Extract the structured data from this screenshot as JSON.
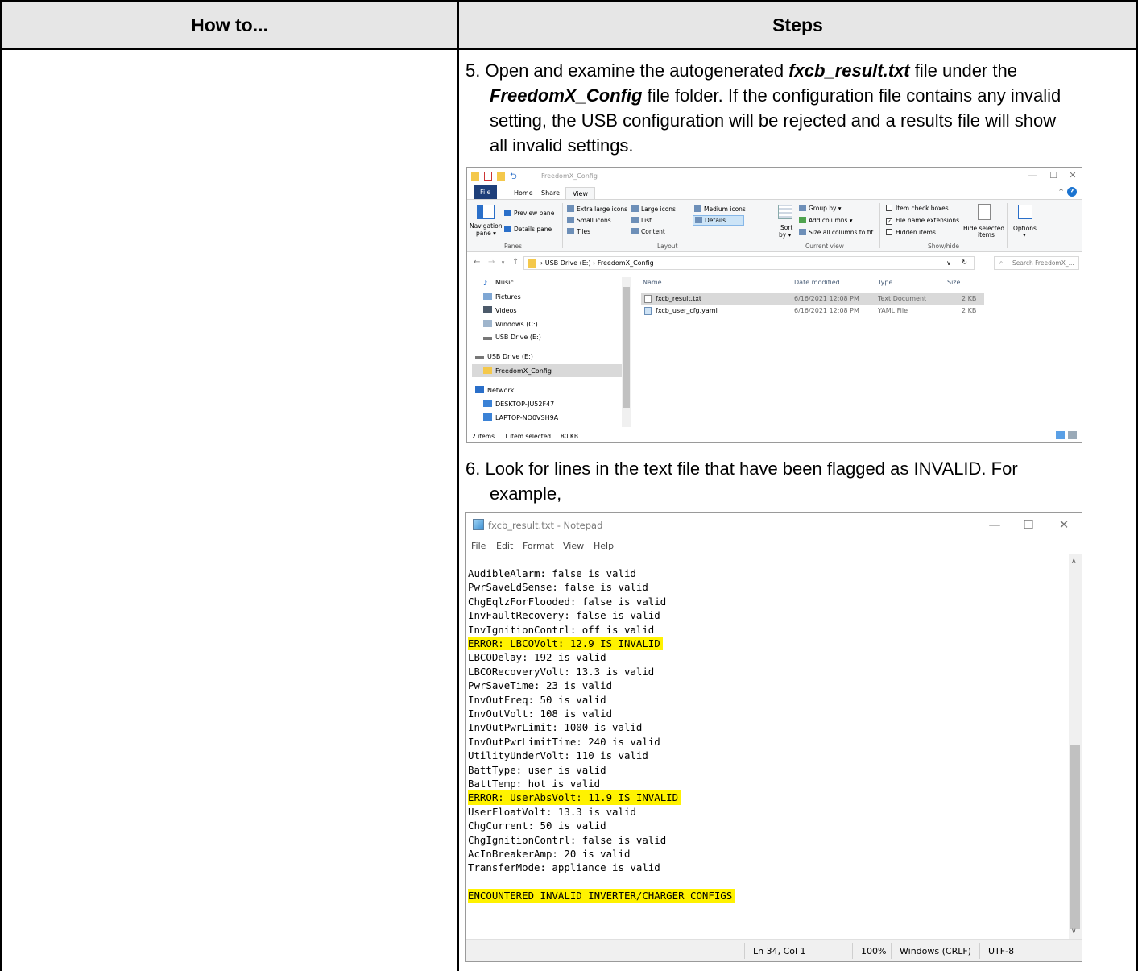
{
  "table": {
    "header_left": "How to...",
    "header_right": "Steps"
  },
  "step5": {
    "number": "5.",
    "text_a": "Open and examine the autogenerated",
    "file_name": "fxcb_result.txt",
    "text_b": "file under the",
    "folder_name": "FreedomX_Config",
    "text_c": "file folder. If the configuration file contains any invalid",
    "line3": "setting, the USB configuration will be rejected and a results file will show",
    "line4": "all invalid settings."
  },
  "step6": {
    "line1": "6. Look for lines in the text file that have been flagged as INVALID. For",
    "line2": "example,"
  },
  "explorer": {
    "title": "FreedomX_Config",
    "tabs": [
      "File",
      "Home",
      "Share",
      "View"
    ],
    "ribbon": {
      "navigation_pane": "Navigation",
      "navigation_pane2": "pane ▾",
      "preview_pane": "Preview pane",
      "details_pane": "Details pane",
      "panes_group": "Panes",
      "extra_large_icons": "Extra large icons",
      "large_icons": "Large icons",
      "medium_icons": "Medium icons",
      "small_icons": "Small icons",
      "list": "List",
      "details": "Details",
      "tiles": "Tiles",
      "content": "Content",
      "layout_group": "Layout",
      "sort_by": "Sort",
      "sort_by2": "by ▾",
      "group_by": "Group by ▾",
      "add_columns": "Add columns ▾",
      "size_all_columns": "Size all columns to fit",
      "current_view_group": "Current view",
      "item_check_boxes": "Item check boxes",
      "file_name_extensions": "File name extensions",
      "hidden_items": "Hidden items",
      "hide_selected": "Hide selected",
      "hide_selected2": "items",
      "show_hide_group": "Show/hide",
      "options": "Options",
      "options2": "▾"
    },
    "address": "›  USB Drive (E:)  ›  FreedomX_Config",
    "search_placeholder": "Search FreedomX_...",
    "nav_items": [
      "Music",
      "Pictures",
      "Videos",
      "Windows (C:)",
      "USB Drive (E:)",
      "USB Drive (E:)",
      "FreedomX_Config",
      "Network",
      "DESKTOP-JU52F47",
      "LAPTOP-NO0VSH9A"
    ],
    "columns": [
      "Name",
      "Date modified",
      "Type",
      "Size"
    ],
    "files": [
      {
        "name": "fxcb_result.txt",
        "date": "6/16/2021 12:08 PM",
        "type": "Text Document",
        "size": "2 KB"
      },
      {
        "name": "fxcb_user_cfg.yaml",
        "date": "6/16/2021 12:08 PM",
        "type": "YAML File",
        "size": "2 KB"
      }
    ],
    "status": "2 items     1 item selected  1.80 KB"
  },
  "notepad": {
    "title": "fxcb_result.txt - Notepad",
    "menu": [
      "File",
      "Edit",
      "Format",
      "View",
      "Help"
    ],
    "lines": [
      {
        "text": "AudibleAlarm: false is valid",
        "hl": false
      },
      {
        "text": "PwrSaveLdSense: false is valid",
        "hl": false
      },
      {
        "text": "ChgEqlzForFlooded: false is valid",
        "hl": false
      },
      {
        "text": "InvFaultRecovery: false is valid",
        "hl": false
      },
      {
        "text": "InvIgnitionContrl: off is valid",
        "hl": false
      },
      {
        "text": "ERROR: LBCOVolt: 12.9 IS INVALID",
        "hl": true
      },
      {
        "text": "LBCODelay: 192 is valid",
        "hl": false
      },
      {
        "text": "LBCORecoveryVolt: 13.3 is valid",
        "hl": false
      },
      {
        "text": "PwrSaveTime: 23 is valid",
        "hl": false
      },
      {
        "text": "InvOutFreq: 50 is valid",
        "hl": false
      },
      {
        "text": "InvOutVolt: 108 is valid",
        "hl": false
      },
      {
        "text": "InvOutPwrLimit: 1000 is valid",
        "hl": false
      },
      {
        "text": "InvOutPwrLimitTime: 240 is valid",
        "hl": false
      },
      {
        "text": "UtilityUnderVolt: 110 is valid",
        "hl": false
      },
      {
        "text": "BattType: user is valid",
        "hl": false
      },
      {
        "text": "BattTemp: hot is valid",
        "hl": false
      },
      {
        "text": "ERROR: UserAbsVolt: 11.9 IS INVALID",
        "hl": true
      },
      {
        "text": "UserFloatVolt: 13.3 is valid",
        "hl": false
      },
      {
        "text": "ChgCurrent: 50 is valid",
        "hl": false
      },
      {
        "text": "ChgIgnitionContrl: false is valid",
        "hl": false
      },
      {
        "text": "AcInBreakerAmp: 20 is valid",
        "hl": false
      },
      {
        "text": "TransferMode: appliance is valid",
        "hl": false
      },
      {
        "text": "",
        "hl": false
      },
      {
        "text": "ENCOUNTERED INVALID INVERTER/CHARGER CONFIGS",
        "hl": true
      }
    ],
    "status": {
      "position": "Ln 34, Col 1",
      "zoom": "100%",
      "line_endings": "Windows (CRLF)",
      "encoding": "UTF-8"
    }
  },
  "colors": {
    "header_bg": "#e6e6e6",
    "highlight": "#fff200",
    "file_tab": "#1e3f7a"
  }
}
